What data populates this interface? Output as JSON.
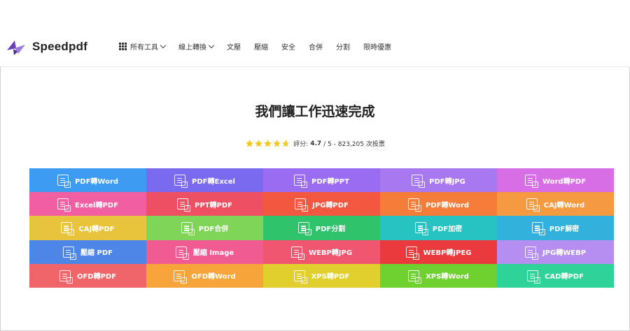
{
  "brand": {
    "name": "Speedpdf"
  },
  "nav": {
    "items": [
      {
        "label": "所有工具",
        "icon": "grid-icon",
        "dropdown": true
      },
      {
        "label": "線上轉換",
        "dropdown": true
      },
      {
        "label": "文壓"
      },
      {
        "label": "壓縮"
      },
      {
        "label": "安全"
      },
      {
        "label": "合併"
      },
      {
        "label": "分割"
      },
      {
        "label": "限時優惠"
      }
    ]
  },
  "hero": {
    "title": "我們讓工作迅速完成",
    "rating_prefix": "評分:",
    "rating_value": "4.7",
    "rating_suffix": "/ 5 - 823,205 次投票",
    "stars": 4.7,
    "star_color": "#f5c518"
  },
  "tools": [
    {
      "label": "PDF轉Word",
      "color": "#3d9bf2",
      "icon": "pdf-to-word-icon"
    },
    {
      "label": "PDF轉Excel",
      "color": "#7a6af0",
      "icon": "pdf-to-excel-icon"
    },
    {
      "label": "PDF轉PPT",
      "color": "#9a6cf2",
      "icon": "pdf-to-ppt-icon"
    },
    {
      "label": "PDF轉JPG",
      "color": "#a778f0",
      "icon": "pdf-to-jpg-icon"
    },
    {
      "label": "Word轉PDF",
      "color": "#d76ee6",
      "icon": "word-to-pdf-icon"
    },
    {
      "label": "Excel轉PDF",
      "color": "#f25ea2",
      "icon": "excel-to-pdf-icon"
    },
    {
      "label": "PPT轉PDF",
      "color": "#ef4f63",
      "icon": "ppt-to-pdf-icon"
    },
    {
      "label": "JPG轉PDF",
      "color": "#f3573f",
      "icon": "jpg-to-pdf-icon"
    },
    {
      "label": "PDF轉Word",
      "color": "#f67c3a",
      "icon": "pdf-to-word-icon"
    },
    {
      "label": "CAJ轉Word",
      "color": "#f59a40",
      "icon": "caj-to-word-icon"
    },
    {
      "label": "CAJ轉PDF",
      "color": "#e8c33c",
      "icon": "caj-to-pdf-icon"
    },
    {
      "label": "PDF合併",
      "color": "#7ed557",
      "icon": "pdf-merge-icon"
    },
    {
      "label": "PDF分割",
      "color": "#2fc46c",
      "icon": "pdf-split-icon"
    },
    {
      "label": "PDF加密",
      "color": "#27c2c2",
      "icon": "pdf-encrypt-icon"
    },
    {
      "label": "PDF解密",
      "color": "#32b1dc",
      "icon": "pdf-decrypt-icon"
    },
    {
      "label": "壓縮 PDF",
      "color": "#4d86e6",
      "icon": "compress-pdf-icon"
    },
    {
      "label": "壓縮 Image",
      "color": "#f05b92",
      "icon": "compress-image-icon"
    },
    {
      "label": "WEBP轉JPG",
      "color": "#f0566f",
      "icon": "webp-to-jpg-icon"
    },
    {
      "label": "WEBP轉JPEG",
      "color": "#ea3a3e",
      "icon": "webp-to-jpeg-icon"
    },
    {
      "label": "JPG轉WEBP",
      "color": "#b68ef2",
      "icon": "jpg-to-webp-icon"
    },
    {
      "label": "OFD轉PDF",
      "color": "#f0656a",
      "icon": "ofd-to-pdf-icon"
    },
    {
      "label": "OFD轉Word",
      "color": "#f7a43a",
      "icon": "ofd-to-word-icon"
    },
    {
      "label": "XPS轉PDF",
      "color": "#e0cf2c",
      "icon": "xps-to-pdf-icon"
    },
    {
      "label": "XPS轉Word",
      "color": "#6fd12f",
      "icon": "xps-to-word-icon"
    },
    {
      "label": "CAD轉PDF",
      "color": "#2fd39a",
      "icon": "cad-to-pdf-icon"
    }
  ]
}
